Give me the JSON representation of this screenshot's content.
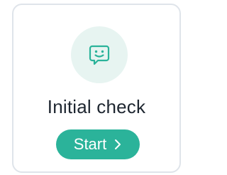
{
  "card": {
    "title": "Initial check",
    "icon": "chat-smile-icon",
    "button_label": "Start",
    "button_icon": "chevron-right-icon"
  },
  "colors": {
    "accent": "#2bb39a",
    "icon_bg": "#e7f4f1",
    "border": "#dfe4ea",
    "title_text": "#1e2630"
  }
}
